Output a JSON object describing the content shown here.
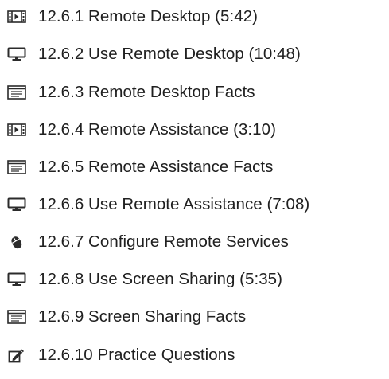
{
  "lessons": [
    {
      "icon": "video-icon",
      "label": "12.6.1 Remote Desktop (5:42)"
    },
    {
      "icon": "monitor-icon",
      "label": "12.6.2 Use Remote Desktop (10:48)"
    },
    {
      "icon": "document-icon",
      "label": "12.6.3 Remote Desktop Facts"
    },
    {
      "icon": "video-icon",
      "label": "12.6.4 Remote Assistance (3:10)"
    },
    {
      "icon": "document-icon",
      "label": "12.6.5 Remote Assistance Facts"
    },
    {
      "icon": "monitor-icon",
      "label": "12.6.6 Use Remote Assistance (7:08)"
    },
    {
      "icon": "mouse-icon",
      "label": "12.6.7 Configure Remote Services"
    },
    {
      "icon": "monitor-icon",
      "label": "12.6.8 Use Screen Sharing (5:35)"
    },
    {
      "icon": "document-icon",
      "label": "12.6.9 Screen Sharing Facts"
    },
    {
      "icon": "pencil-check-icon",
      "label": "12.6.10 Practice Questions"
    }
  ],
  "colors": {
    "icon": "#2b2b2b",
    "text": "#202020"
  }
}
